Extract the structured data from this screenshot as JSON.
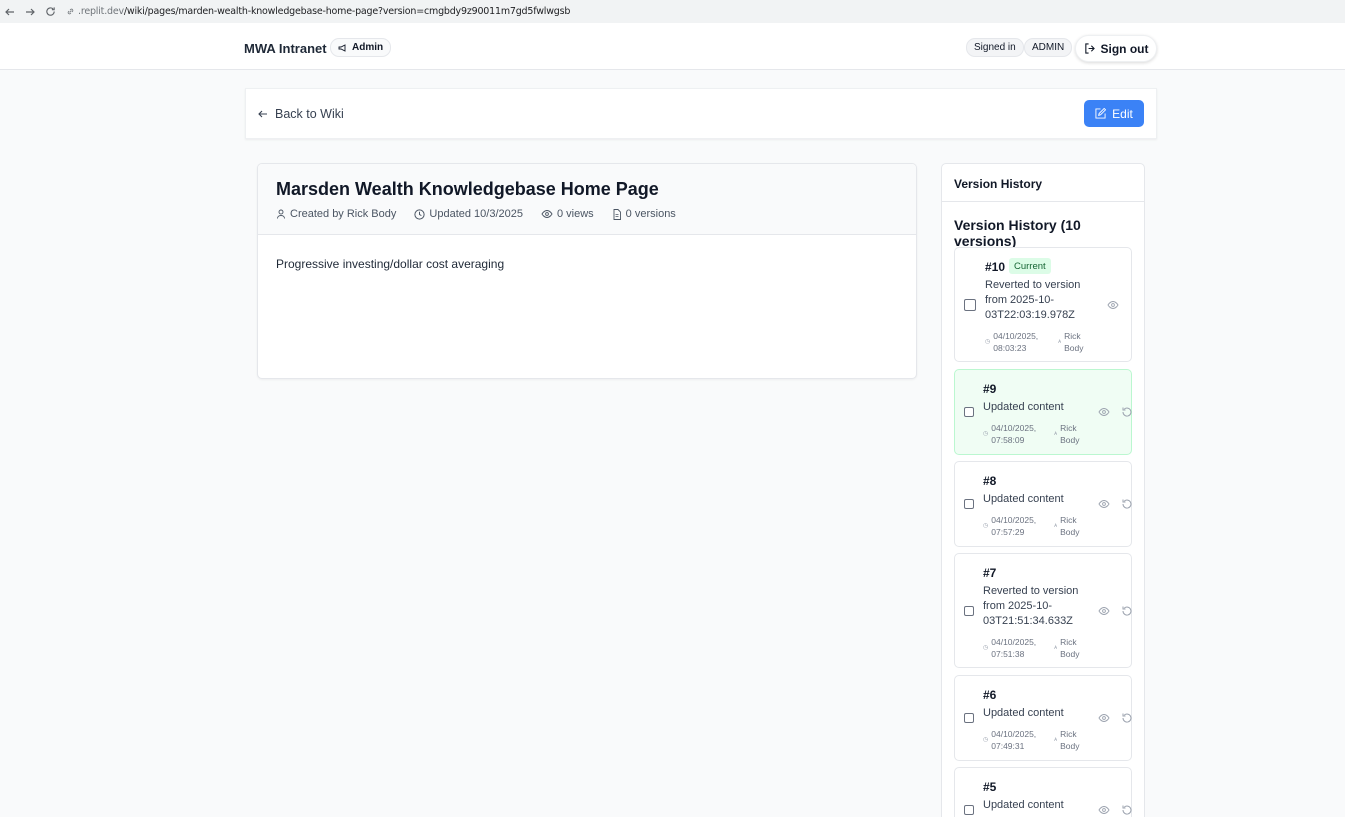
{
  "browser": {
    "url_host": ".replit.dev",
    "url_path": "/wiki/pages/marden-wealth-knowledgebase-home-page?version=cmgbdy9z90011m7gd5fwlwgsb"
  },
  "header": {
    "brand": "MWA Intranet",
    "admin_badge": "Admin",
    "signed_in": "Signed in",
    "role": "ADMIN",
    "sign_out": "Sign out"
  },
  "toolbar": {
    "back_label": "Back to Wiki",
    "edit_label": "Edit"
  },
  "page": {
    "title": "Marsden Wealth Knowledgebase Home Page",
    "created_by": "Created by Rick Body",
    "updated": "Updated 10/3/2025",
    "views": "0 views",
    "versions": "0 versions",
    "content": "Progressive investing/dollar cost averaging"
  },
  "history": {
    "panel_title": "Version History",
    "heading": "Version History (10 versions)",
    "current_label": "Current",
    "items": [
      {
        "num": "#10",
        "desc": "Reverted to version from 2025-10-03T22:03:19.978Z",
        "date": "04/10/2025,",
        "time": "08:03:23",
        "user1": "Rick",
        "user2": "Body"
      },
      {
        "num": "#9",
        "desc": "Updated content",
        "date": "04/10/2025,",
        "time": "07:58:09",
        "user1": "Rick",
        "user2": "Body"
      },
      {
        "num": "#8",
        "desc": "Updated content",
        "date": "04/10/2025,",
        "time": "07:57:29",
        "user1": "Rick",
        "user2": "Body"
      },
      {
        "num": "#7",
        "desc": "Reverted to version from 2025-10-03T21:51:34.633Z",
        "date": "04/10/2025,",
        "time": "07:51:38",
        "user1": "Rick",
        "user2": "Body"
      },
      {
        "num": "#6",
        "desc": "Updated content",
        "date": "04/10/2025,",
        "time": "07:49:31",
        "user1": "Rick",
        "user2": "Body"
      },
      {
        "num": "#5",
        "desc": "Updated content"
      }
    ]
  }
}
